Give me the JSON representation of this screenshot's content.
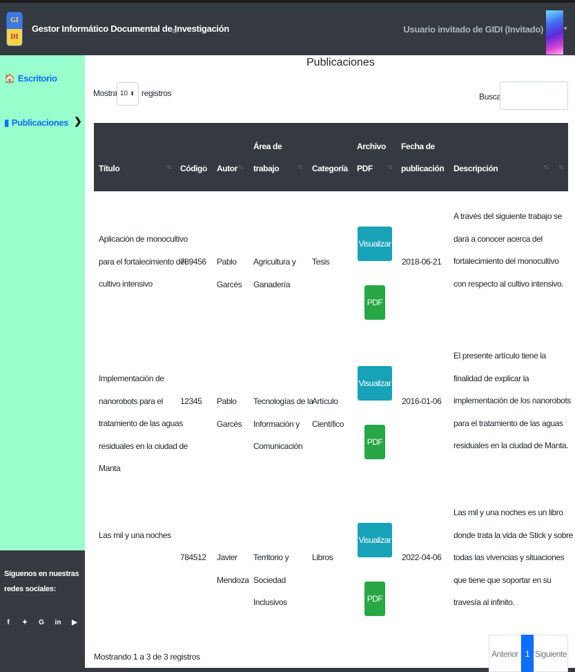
{
  "navbar": {
    "logo_top": "GI",
    "logo_bottom": "DI",
    "app_title": "Gestor Informático Documental de Investigación",
    "menu_toggle": "≡",
    "user_name": "Usuario invitado de GIDI (Invitado)",
    "user_caret": "▾"
  },
  "sidebar": {
    "items": [
      {
        "label": "Escritorio",
        "icon": "home-icon",
        "glyph": "🏠"
      },
      {
        "label": "Publicaciones",
        "icon": "book-icon",
        "glyph": "▮"
      }
    ],
    "expand_caret": "❯",
    "social_title": "Síguenos en nuestras redes sociales:",
    "social_icons": [
      {
        "name": "facebook-icon",
        "glyph": "f"
      },
      {
        "name": "twitter-icon",
        "glyph": "✦"
      },
      {
        "name": "google-plus-icon",
        "glyph": "G"
      },
      {
        "name": "linkedin-icon",
        "glyph": "in"
      },
      {
        "name": "youtube-icon",
        "glyph": "▶"
      }
    ]
  },
  "page": {
    "title": "Publicaciones",
    "length_prefix": "Mostrar",
    "length_value": "10",
    "length_suffix": "registros",
    "search_label": "Buscar:",
    "search_value": ""
  },
  "table": {
    "columns": {
      "titulo": "Título",
      "codigo": "Código",
      "autor": "Autor",
      "area": "Área de\ntrabajo",
      "categoria": "Categoría",
      "archivo": "Archivo\nPDF",
      "fecha": "Fecha de\npublicación",
      "descripcion": "Descripción"
    },
    "sort_glyph": "↑↓",
    "view_button": "Visualizar",
    "pdf_button": "PDF",
    "rows": [
      {
        "titulo": "Aplicación de monocultivo\npara el fortalecimiento del\ncultivo intensivo",
        "codigo": "789456",
        "autor": "Pablo\nGarcés",
        "area": "Agricultura y\nGanadería",
        "categoria": "Tesis",
        "fecha": "2018-06-21",
        "descripcion": "A través del siguiente trabajo se\ndará a conocer acerca del\nfortalecimiento del monocultivo\ncon respecto al cultivo intensivo."
      },
      {
        "titulo": "Implementación de\nnanorobots para el\ntratamiento de las aguas\nresiduales en la ciudad de\nManta",
        "codigo": "12345",
        "autor": "Pablo\nGarcés",
        "area": "Tecnologías de la\nInformación y\nComunicación",
        "categoria": "Artículo\nCientífico",
        "fecha": "2016-01-06",
        "descripcion": "El presente artículo tiene la\nfinalidad de explicar la\nimplementación de los nanorobots\npara el tratamiento de las aguas\nresiduales en la ciudad de Manta."
      },
      {
        "titulo": "Las mil y una noches",
        "codigo": "784512",
        "autor": "Javier\nMendoza",
        "area": "Territorio y\nSociedad\nInclusivos",
        "categoria": "Libros",
        "fecha": "2022-04-06",
        "descripcion": "Las mil y una noches es un libro\ndonde trata la vida de Stick y sobre\ntodas las vivencias y situaciones\nque tiene que soportar en su\ntravesía al infinito."
      }
    ]
  },
  "footer": {
    "info": "Mostrando 1 a 3 de 3 registros",
    "prev": "Anterior",
    "current_page": "1",
    "next": "Siguiente"
  },
  "colors": {
    "navbar": "#343a40",
    "sidebar": "#99ffcc",
    "link": "#0d6efd",
    "view_button": "#17a2b8",
    "pdf_button": "#28a745"
  }
}
